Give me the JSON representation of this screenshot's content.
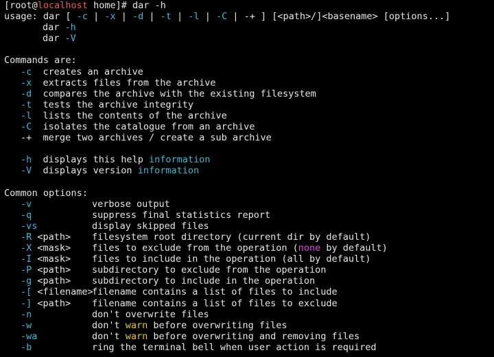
{
  "prompt": {
    "bracket_open": "[root@",
    "host": "localhost",
    "path_part": " home]# ",
    "command": "dar -h"
  },
  "usage": {
    "line1_prefix": "usage: dar [ ",
    "flags": [
      "-c",
      "-x",
      "-d",
      "-t",
      "-l",
      "-C"
    ],
    "separator": " | ",
    "line1_tail": " | -+ ] [<path>/]<basename> [options...]",
    "line2_cmd": "dar ",
    "line2_flag": "-h",
    "line3_cmd": "dar ",
    "line3_flag": "-V"
  },
  "commands": {
    "heading": "Commands are:",
    "items": [
      {
        "flag": "-c",
        "text": "  creates an archive"
      },
      {
        "flag": "-x",
        "text": "  extracts files from the archive"
      },
      {
        "flag": "-d",
        "text": "  compares the archive with the existing filesystem"
      },
      {
        "flag": "-t",
        "text": "  tests the archive integrity"
      },
      {
        "flag": "-l",
        "text": "  lists the contents of the archive"
      },
      {
        "flag": "-C",
        "text": "  isolates the catalogue from an archive"
      },
      {
        "flag": "-+",
        "text": "  merge two archives / create a sub archive"
      }
    ],
    "help": {
      "flag": "-h",
      "text": "  displays this help ",
      "highlight": "information"
    },
    "version": {
      "flag": "-V",
      "text": "  displays version ",
      "highlight": "information"
    }
  },
  "options": {
    "heading": "Common options:",
    "items": [
      {
        "flag": "-v",
        "arg": "",
        "desc": "verbose output"
      },
      {
        "flag": "-q",
        "arg": "",
        "desc": "suppress final statistics report"
      },
      {
        "flag": "-vs",
        "arg": "",
        "desc": "display skipped files"
      },
      {
        "flag": "-R",
        "arg": " <path>",
        "desc": "filesystem root directory (current dir by default)"
      },
      {
        "flag": "-X",
        "arg": " <mask>",
        "desc_pre": "files to exclude from the operation (",
        "desc_hl": "none",
        "desc_post": " by default)"
      },
      {
        "flag": "-I",
        "arg": " <mask>",
        "desc": "files to include in the operation (all by default)"
      },
      {
        "flag": "-P",
        "arg": " <path>",
        "desc": "subdirectory to exclude from the operation"
      },
      {
        "flag": "-g",
        "arg": " <path>",
        "desc": "subdirectory to include in the operation"
      },
      {
        "flag": "-[",
        "arg": " <filename>",
        "desc": "filename contains a list of files to include"
      },
      {
        "flag": "-]",
        "arg": " <path>",
        "desc": "filename contains a list of files to exclude"
      },
      {
        "flag": "-n",
        "arg": "",
        "desc": "don't overwrite files"
      },
      {
        "flag": "-w",
        "arg": "",
        "desc_pre": "don't ",
        "desc_hl": "warn",
        "desc_post": " before overwriting files"
      },
      {
        "flag": "-wa",
        "arg": "",
        "desc_pre": "don't ",
        "desc_hl": "warn",
        "desc_post": " before overwriting and removing files"
      },
      {
        "flag": "-b",
        "arg": "",
        "desc": "ring the terminal bell when user action is required"
      }
    ]
  },
  "colors": {
    "background": "#000000",
    "text": "#e6e6e6",
    "flag": "#3fb7d6",
    "host": "#e85a5a",
    "keyword_magenta": "#e04ae0",
    "keyword_yellow": "#e5c52b"
  }
}
